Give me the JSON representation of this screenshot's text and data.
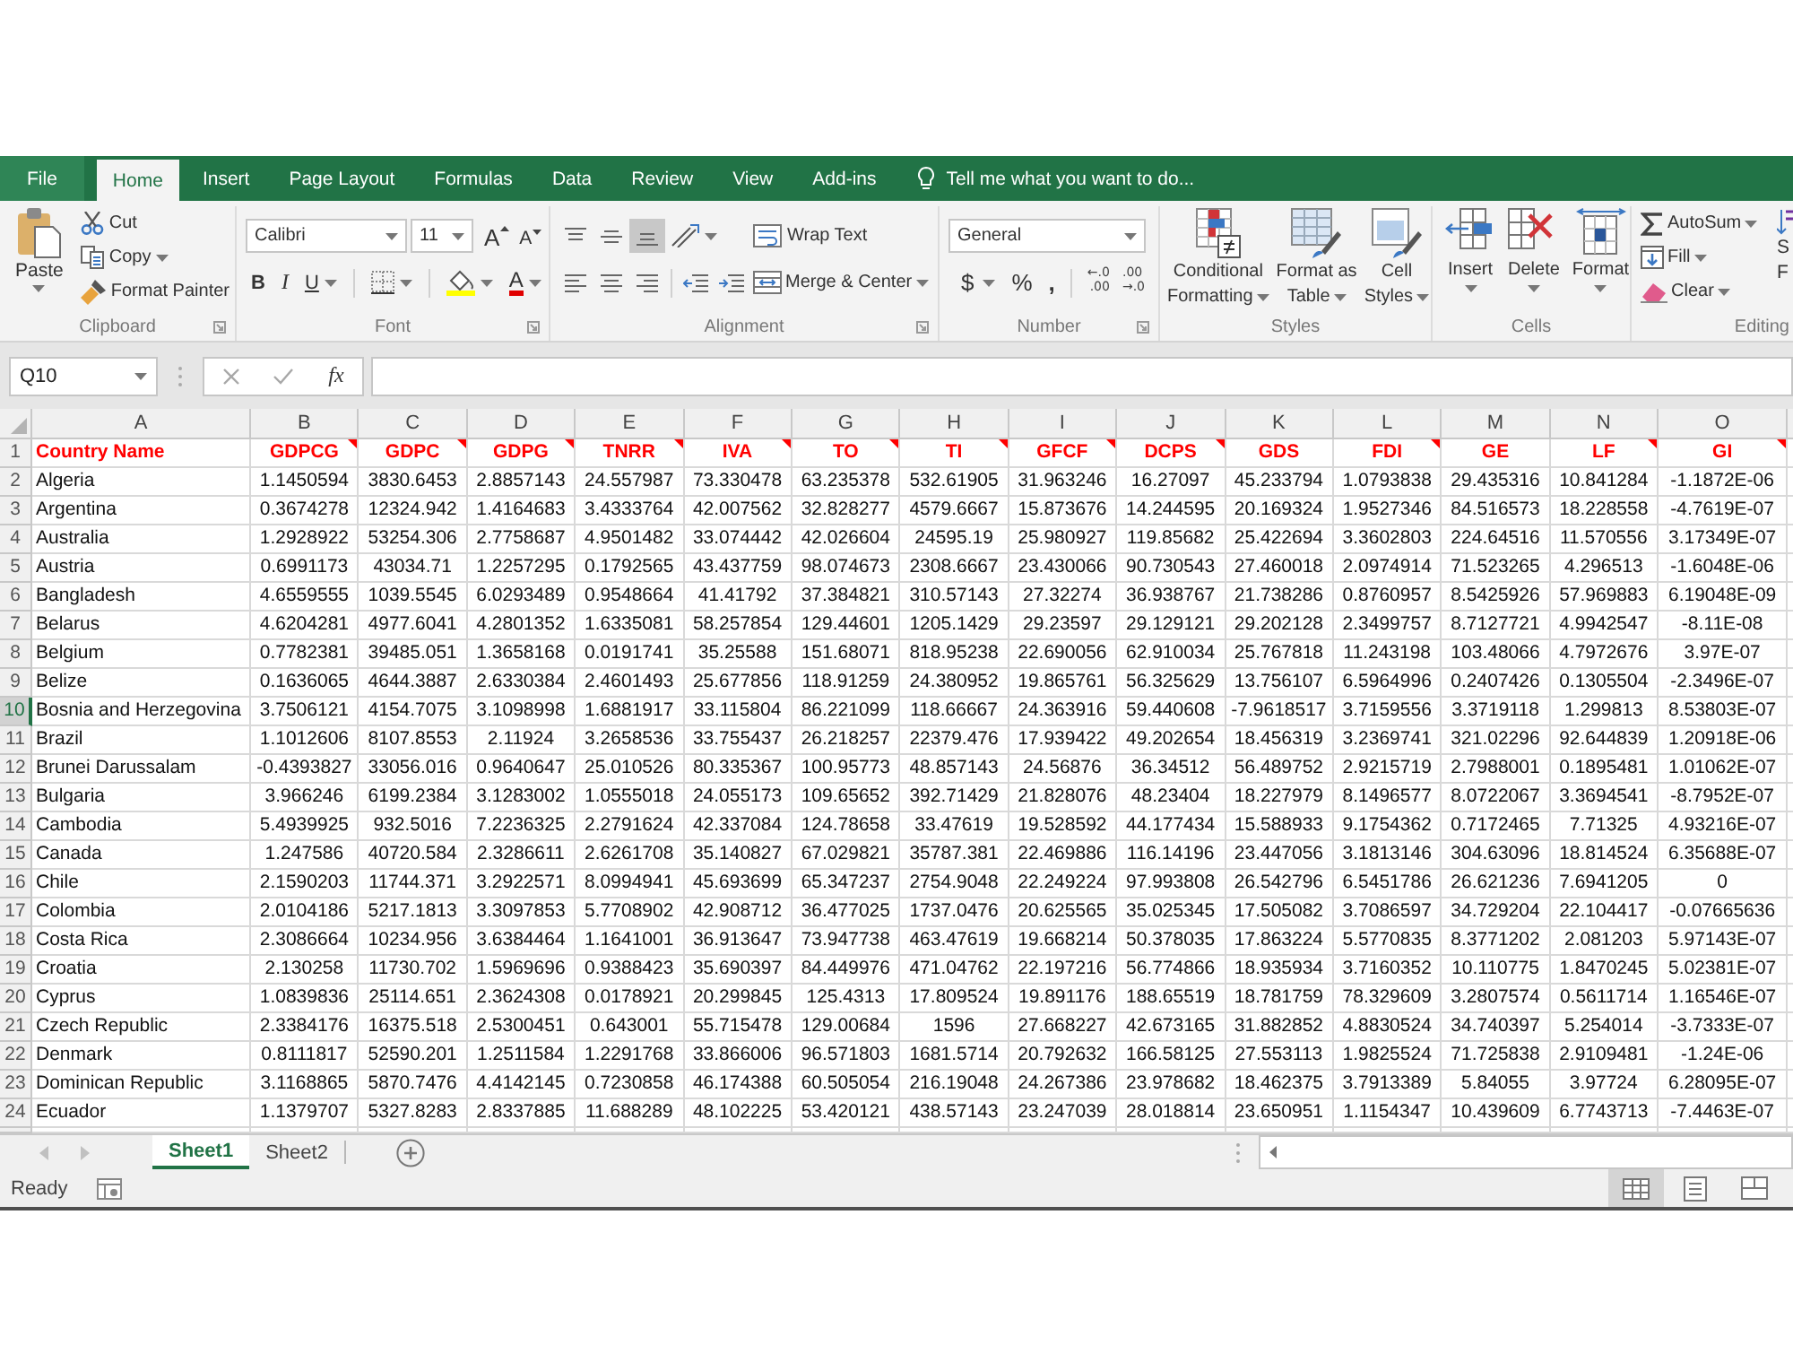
{
  "window": {
    "tabs": [
      {
        "label": "File",
        "kind": "file",
        "selected": false
      },
      {
        "label": "Home",
        "kind": "tab",
        "selected": true
      },
      {
        "label": "Insert",
        "kind": "tab",
        "selected": false
      },
      {
        "label": "Page Layout",
        "kind": "tab",
        "selected": false
      },
      {
        "label": "Formulas",
        "kind": "tab",
        "selected": false
      },
      {
        "label": "Data",
        "kind": "tab",
        "selected": false
      },
      {
        "label": "Review",
        "kind": "tab",
        "selected": false
      },
      {
        "label": "View",
        "kind": "tab",
        "selected": false
      },
      {
        "label": "Add-ins",
        "kind": "tab",
        "selected": false
      }
    ],
    "tell_me": "Tell me what you want to do..."
  },
  "ribbon": {
    "clipboard": {
      "label": "Clipboard",
      "paste": "Paste",
      "cut": "Cut",
      "copy": "Copy",
      "format_painter": "Format Painter"
    },
    "font": {
      "label": "Font",
      "font_name": "Calibri",
      "font_size": "11",
      "grow": "A",
      "shrink": "A",
      "bold": "B",
      "italic": "I",
      "underline": "U",
      "font_color": "A"
    },
    "alignment": {
      "label": "Alignment",
      "vertical": [
        {
          "kind": "top",
          "selected": false
        },
        {
          "kind": "middle",
          "selected": false
        },
        {
          "kind": "bottom",
          "selected": true
        }
      ],
      "horizontal": [
        {
          "kind": "left",
          "selected": false
        },
        {
          "kind": "center",
          "selected": false
        },
        {
          "kind": "right",
          "selected": false
        }
      ],
      "wrap_text": "Wrap Text",
      "merge_center": "Merge & Center"
    },
    "number": {
      "label": "Number",
      "format": "General",
      "currency": "$",
      "percent": "%",
      "comma": ",",
      "decimals": [
        {
          "kind": "increase",
          "lines": [
            "←.0",
            ".00"
          ]
        },
        {
          "kind": "decrease",
          "lines": [
            ".00",
            "→.0"
          ]
        }
      ]
    },
    "styles": {
      "label": "Styles",
      "buttons": [
        {
          "kind": "conditional",
          "lines": [
            "Conditional",
            "Formatting"
          ]
        },
        {
          "kind": "table",
          "lines": [
            "Format as",
            "Table"
          ]
        },
        {
          "kind": "cell_styles",
          "lines": [
            "Cell",
            "Styles"
          ]
        }
      ]
    },
    "cells": {
      "label": "Cells",
      "buttons": [
        {
          "kind": "insert",
          "label": "Insert"
        },
        {
          "kind": "delete",
          "label": "Delete"
        },
        {
          "kind": "format",
          "label": "Format"
        }
      ]
    },
    "editing": {
      "label": "Editing",
      "autosum": "AutoSum",
      "fill": "Fill",
      "clear": "Clear",
      "sort_filter": [
        "S",
        "F"
      ]
    }
  },
  "formula_bar": {
    "name_box": "Q10",
    "function_label": "fx"
  },
  "sheet": {
    "columns": [
      "A",
      "B",
      "C",
      "D",
      "E",
      "F",
      "G",
      "H",
      "I",
      "J",
      "K",
      "L",
      "M",
      "N",
      "O"
    ],
    "header_row": {
      "number": "1",
      "selected": false,
      "cells": [
        {
          "text": "Country Name",
          "comment": false
        },
        {
          "text": "GDPCG",
          "comment": true
        },
        {
          "text": "GDPC",
          "comment": true
        },
        {
          "text": "GDPG",
          "comment": true
        },
        {
          "text": "TNRR",
          "comment": true
        },
        {
          "text": "IVA",
          "comment": true
        },
        {
          "text": "TO",
          "comment": true
        },
        {
          "text": "TI",
          "comment": true
        },
        {
          "text": "GFCF",
          "comment": true
        },
        {
          "text": "DCPS",
          "comment": true
        },
        {
          "text": "GDS",
          "comment": false
        },
        {
          "text": "FDI",
          "comment": true
        },
        {
          "text": "GE",
          "comment": false
        },
        {
          "text": "LF",
          "comment": true
        },
        {
          "text": "GI",
          "comment": true
        }
      ]
    },
    "rows": [
      {
        "number": "2",
        "selected": false,
        "cells": [
          "Algeria",
          "1.1450594",
          "3830.6453",
          "2.8857143",
          "24.557987",
          "73.330478",
          "63.235378",
          "532.61905",
          "31.963246",
          "16.27097",
          "45.233794",
          "1.0793838",
          "29.435316",
          "10.841284",
          "-1.1872E-06"
        ]
      },
      {
        "number": "3",
        "selected": false,
        "cells": [
          "Argentina",
          "0.3674278",
          "12324.942",
          "1.4164683",
          "3.4333764",
          "42.007562",
          "32.828277",
          "4579.6667",
          "15.873676",
          "14.244595",
          "20.169324",
          "1.9527346",
          "84.516573",
          "18.228558",
          "-4.7619E-07"
        ]
      },
      {
        "number": "4",
        "selected": false,
        "cells": [
          "Australia",
          "1.2928922",
          "53254.306",
          "2.7758687",
          "4.9501482",
          "33.074442",
          "42.026604",
          "24595.19",
          "25.980927",
          "119.85682",
          "25.422694",
          "3.3602803",
          "224.64516",
          "11.570556",
          "3.17349E-07"
        ]
      },
      {
        "number": "5",
        "selected": false,
        "cells": [
          "Austria",
          "0.6991173",
          "43034.71",
          "1.2257295",
          "0.1792565",
          "43.437759",
          "98.074673",
          "2308.6667",
          "23.430066",
          "90.730543",
          "27.460018",
          "2.0974914",
          "71.523265",
          "4.296513",
          "-1.6048E-06"
        ]
      },
      {
        "number": "6",
        "selected": false,
        "cells": [
          "Bangladesh",
          "4.6559555",
          "1039.5545",
          "6.0293489",
          "0.9548664",
          "41.41792",
          "37.384821",
          "310.57143",
          "27.32274",
          "36.938767",
          "21.738286",
          "0.8760957",
          "8.5425926",
          "57.969883",
          "6.19048E-09"
        ]
      },
      {
        "number": "7",
        "selected": false,
        "cells": [
          "Belarus",
          "4.6204281",
          "4977.6041",
          "4.2801352",
          "1.6335081",
          "58.257854",
          "129.44601",
          "1205.1429",
          "29.23597",
          "29.129121",
          "29.202128",
          "2.3499757",
          "8.7127721",
          "4.9942547",
          "-8.11E-08"
        ]
      },
      {
        "number": "8",
        "selected": false,
        "cells": [
          "Belgium",
          "0.7782381",
          "39485.051",
          "1.3658168",
          "0.0191741",
          "35.25588",
          "151.68071",
          "818.95238",
          "22.690056",
          "62.910034",
          "25.767818",
          "11.243198",
          "103.48066",
          "4.7972676",
          "3.97E-07"
        ]
      },
      {
        "number": "9",
        "selected": false,
        "cells": [
          "Belize",
          "0.1636065",
          "4644.3887",
          "2.6330384",
          "2.4601493",
          "25.677856",
          "118.91259",
          "24.380952",
          "19.865761",
          "56.325629",
          "13.756107",
          "6.5964996",
          "0.2407426",
          "0.1305504",
          "-2.3496E-07"
        ]
      },
      {
        "number": "10",
        "selected": true,
        "cells": [
          "Bosnia and Herzegovina",
          "3.7506121",
          "4154.7075",
          "3.1098998",
          "1.6881917",
          "33.115804",
          "86.221099",
          "118.66667",
          "24.363916",
          "59.440608",
          "-7.9618517",
          "3.7159556",
          "3.3719118",
          "1.299813",
          "8.53803E-07"
        ]
      },
      {
        "number": "11",
        "selected": false,
        "cells": [
          "Brazil",
          "1.1012606",
          "8107.8553",
          "2.11924",
          "3.2658536",
          "33.755437",
          "26.218257",
          "22379.476",
          "17.939422",
          "49.202654",
          "18.456319",
          "3.2369741",
          "321.02296",
          "92.644839",
          "1.20918E-06"
        ]
      },
      {
        "number": "12",
        "selected": false,
        "cells": [
          "Brunei Darussalam",
          "-0.4393827",
          "33056.016",
          "0.9640647",
          "25.010526",
          "80.335367",
          "100.95773",
          "48.857143",
          "24.56876",
          "36.34512",
          "56.489752",
          "2.9215719",
          "2.7988001",
          "0.1895481",
          "1.01062E-07"
        ]
      },
      {
        "number": "13",
        "selected": false,
        "cells": [
          "Bulgaria",
          "3.966246",
          "6199.2384",
          "3.1283002",
          "1.0555018",
          "24.055173",
          "109.65652",
          "392.71429",
          "21.828076",
          "48.23404",
          "18.227979",
          "8.1496577",
          "8.0722067",
          "3.3694541",
          "-8.7952E-07"
        ]
      },
      {
        "number": "14",
        "selected": false,
        "cells": [
          "Cambodia",
          "5.4939925",
          "932.5016",
          "7.2236325",
          "2.2791624",
          "42.337084",
          "124.78658",
          "33.47619",
          "19.528592",
          "44.177434",
          "15.588933",
          "9.1754362",
          "0.7172465",
          "7.71325",
          "4.93216E-07"
        ]
      },
      {
        "number": "15",
        "selected": false,
        "cells": [
          "Canada",
          "1.247586",
          "40720.584",
          "2.3286611",
          "2.6261708",
          "35.140827",
          "67.029821",
          "35787.381",
          "22.469886",
          "116.14196",
          "23.447056",
          "3.1813146",
          "304.63096",
          "18.814524",
          "6.35688E-07"
        ]
      },
      {
        "number": "16",
        "selected": false,
        "cells": [
          "Chile",
          "2.1590203",
          "11744.371",
          "3.2922571",
          "8.0994941",
          "45.693699",
          "65.347237",
          "2754.9048",
          "22.249224",
          "97.993808",
          "26.542796",
          "6.5451786",
          "26.621236",
          "7.6941205",
          "0"
        ]
      },
      {
        "number": "17",
        "selected": false,
        "cells": [
          "Colombia",
          "2.0104186",
          "5217.1813",
          "3.3097853",
          "5.7708902",
          "42.908712",
          "36.477025",
          "1737.0476",
          "20.625565",
          "35.025345",
          "17.505082",
          "3.7086597",
          "34.729204",
          "22.104417",
          "-0.07665636"
        ]
      },
      {
        "number": "18",
        "selected": false,
        "cells": [
          "Costa Rica",
          "2.3086664",
          "10234.956",
          "3.6384464",
          "1.1641001",
          "36.913647",
          "73.947738",
          "463.47619",
          "19.668214",
          "50.378035",
          "17.863224",
          "5.5770835",
          "8.3771202",
          "2.081203",
          "5.97143E-07"
        ]
      },
      {
        "number": "19",
        "selected": false,
        "cells": [
          "Croatia",
          "2.130258",
          "11730.702",
          "1.5969696",
          "0.9388423",
          "35.690397",
          "84.449976",
          "471.04762",
          "22.197216",
          "56.774866",
          "18.935934",
          "3.7160352",
          "10.110775",
          "1.8470245",
          "5.02381E-07"
        ]
      },
      {
        "number": "20",
        "selected": false,
        "cells": [
          "Cyprus",
          "1.0839836",
          "25114.651",
          "2.3624308",
          "0.0178921",
          "20.299845",
          "125.4313",
          "17.809524",
          "19.891176",
          "188.65519",
          "18.781759",
          "78.329609",
          "3.2807574",
          "0.5611714",
          "1.16546E-07"
        ]
      },
      {
        "number": "21",
        "selected": false,
        "cells": [
          "Czech Republic",
          "2.3384176",
          "16375.518",
          "2.5300451",
          "0.643001",
          "55.715478",
          "129.00684",
          "1596",
          "27.668227",
          "42.673165",
          "31.882852",
          "4.8830524",
          "34.740397",
          "5.254014",
          "-3.7333E-07"
        ]
      },
      {
        "number": "22",
        "selected": false,
        "cells": [
          "Denmark",
          "0.8111817",
          "52590.201",
          "1.2511584",
          "1.2291768",
          "33.866006",
          "96.571803",
          "1681.5714",
          "20.792632",
          "166.58125",
          "27.553113",
          "1.9825524",
          "71.725838",
          "2.9109481",
          "-1.24E-06"
        ]
      },
      {
        "number": "23",
        "selected": false,
        "cells": [
          "Dominican Republic",
          "3.1168865",
          "5870.7476",
          "4.4142145",
          "0.7230858",
          "46.174388",
          "60.505054",
          "216.19048",
          "24.267386",
          "23.978682",
          "18.462375",
          "3.7913389",
          "5.84055",
          "3.97724",
          "6.28095E-07"
        ]
      },
      {
        "number": "24",
        "selected": false,
        "cells": [
          "Ecuador",
          "1.1379707",
          "5327.8283",
          "2.8337885",
          "11.688289",
          "48.102225",
          "53.420121",
          "438.57143",
          "23.247039",
          "28.018814",
          "23.650951",
          "1.1154347",
          "10.439609",
          "6.7743713",
          "-7.4463E-07"
        ]
      }
    ]
  },
  "sheet_tabs": [
    {
      "label": "Sheet1",
      "selected": true
    },
    {
      "label": "Sheet2",
      "selected": false
    }
  ],
  "status_bar": {
    "text": "Ready",
    "views": [
      {
        "kind": "normal",
        "selected": true
      },
      {
        "kind": "page_layout",
        "selected": false
      },
      {
        "kind": "page_break",
        "selected": false
      }
    ]
  }
}
